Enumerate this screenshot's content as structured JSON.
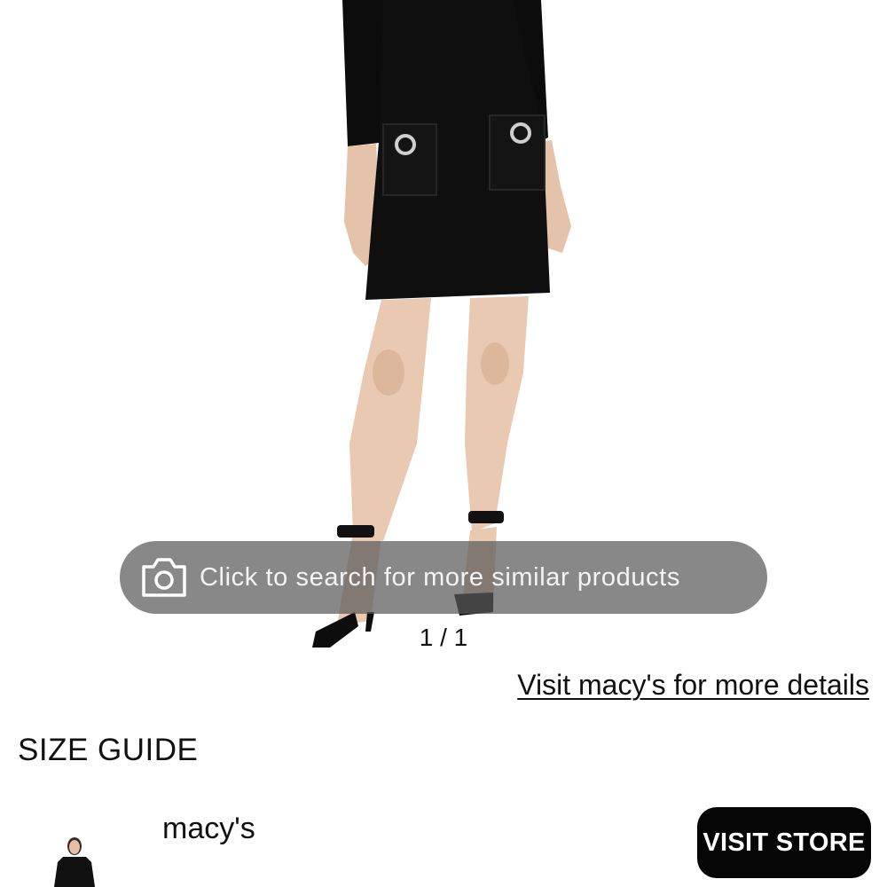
{
  "visual_search": {
    "label": "Click to search for more similar products",
    "icon": "camera-icon"
  },
  "pager": {
    "text": "1 / 1"
  },
  "retailer_link": {
    "label": "Visit macy's for more details"
  },
  "size_guide": {
    "label": "SIZE GUIDE"
  },
  "store": {
    "name": "macy's",
    "button_label": "VISIT STORE"
  },
  "colors": {
    "pill_background": "#5a5a5a",
    "button_background": "#050505",
    "text": "#111111"
  }
}
